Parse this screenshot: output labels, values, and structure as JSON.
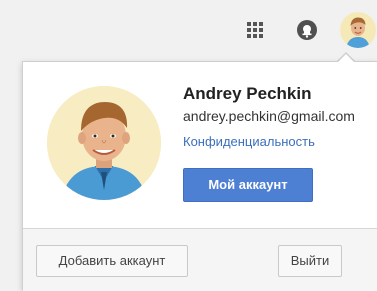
{
  "topbar": {
    "apps_icon": "apps-grid-icon",
    "notifications_icon": "notifications-bell-icon",
    "avatar": "user-avatar"
  },
  "account_card": {
    "name": "Andrey Pechkin",
    "email": "andrey.pechkin@gmail.com",
    "privacy_link": "Конфиденциальность",
    "my_account_button": "Мой аккаунт"
  },
  "footer": {
    "add_account_button": "Добавить аккаунт",
    "logout_button": "Выйти"
  },
  "colors": {
    "accent": "#4d7fd3",
    "link": "#3b6fbd"
  }
}
